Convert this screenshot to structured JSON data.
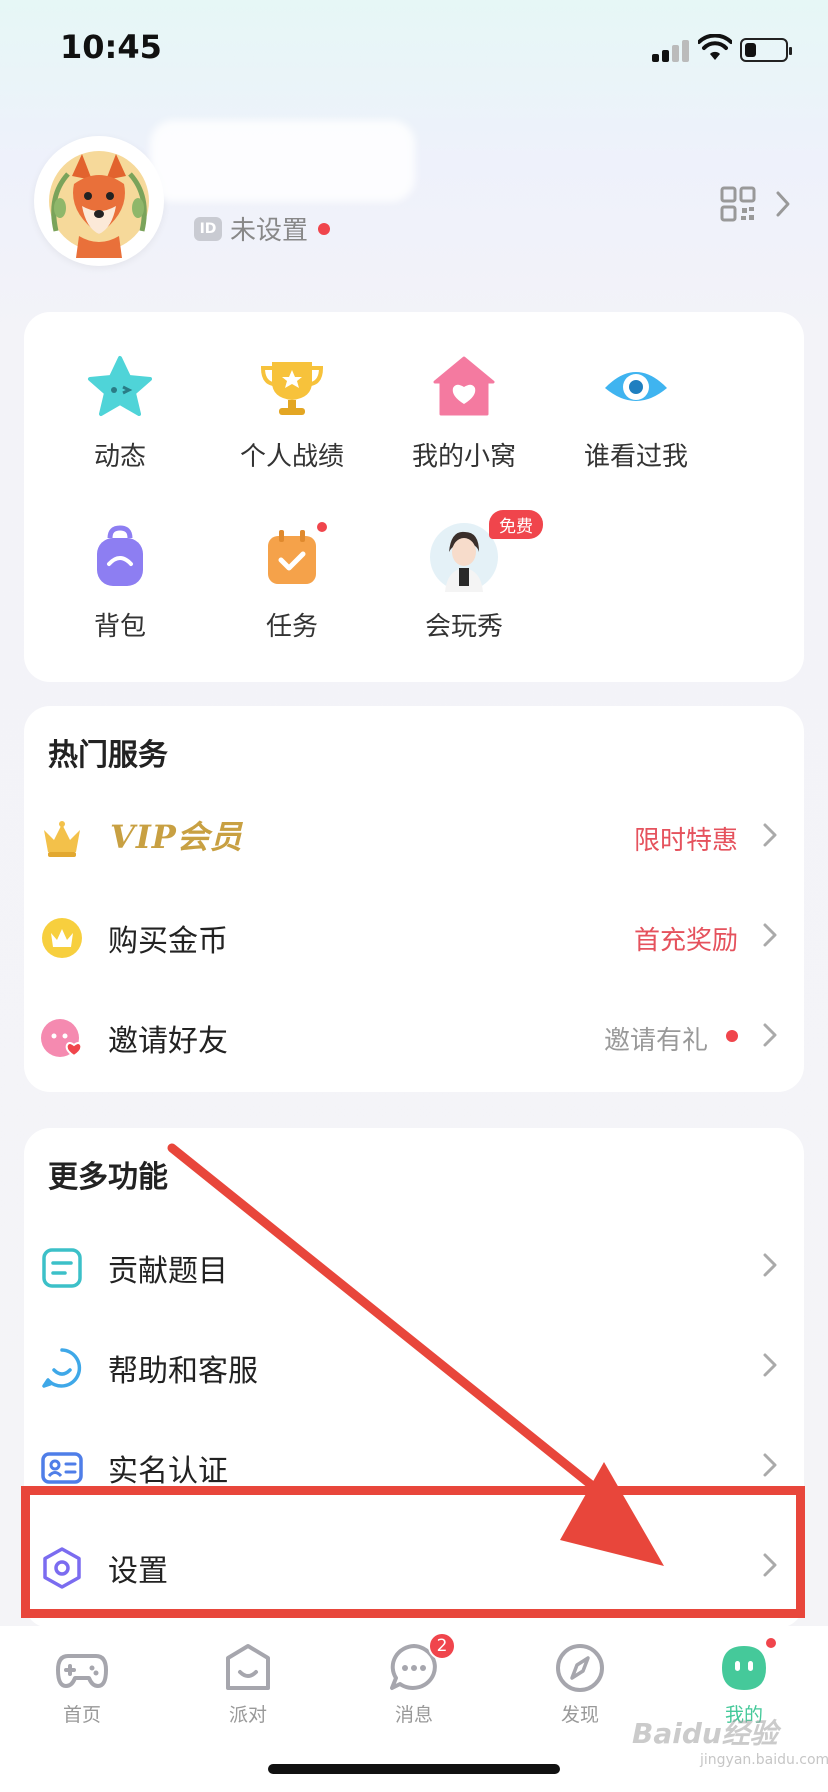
{
  "status_bar": {
    "time": "10:45",
    "battery_level": 0.3
  },
  "profile": {
    "id_badge": "ID",
    "id_status": "未设置"
  },
  "quick_grid": {
    "items": [
      {
        "label": "动态",
        "icon": "star-face-icon"
      },
      {
        "label": "个人战绩",
        "icon": "trophy-icon"
      },
      {
        "label": "我的小窝",
        "icon": "house-heart-icon"
      },
      {
        "label": "谁看过我",
        "icon": "eye-icon"
      },
      {
        "label": "背包",
        "icon": "backpack-icon"
      },
      {
        "label": "任务",
        "icon": "task-calendar-icon"
      },
      {
        "label": "会玩秀",
        "icon": "avatar-show-icon",
        "badge": "免费"
      }
    ]
  },
  "hot_services": {
    "title": "热门服务",
    "rows": [
      {
        "label": "VIP会员",
        "right_text": "限时特惠"
      },
      {
        "label": "购买金币",
        "right_text": "首充奖励"
      },
      {
        "label": "邀请好友",
        "right_text": "邀请有礼"
      }
    ]
  },
  "more_functions": {
    "title": "更多功能",
    "rows": [
      {
        "label": "贡献题目"
      },
      {
        "label": "帮助和客服"
      },
      {
        "label": "实名认证"
      },
      {
        "label": "设置"
      }
    ]
  },
  "tab_bar": {
    "tabs": [
      {
        "label": "首页"
      },
      {
        "label": "派对"
      },
      {
        "label": "消息",
        "badge": "2"
      },
      {
        "label": "发现"
      },
      {
        "label": "我的"
      }
    ]
  },
  "watermark": {
    "brand": "Baidu经验",
    "url": "jingyan.baidu.com"
  },
  "colors": {
    "accent_green": "#45c99a",
    "alert_red": "#f0454c",
    "annotation_red": "#e8463b",
    "vip_gold": "#c8a042"
  }
}
